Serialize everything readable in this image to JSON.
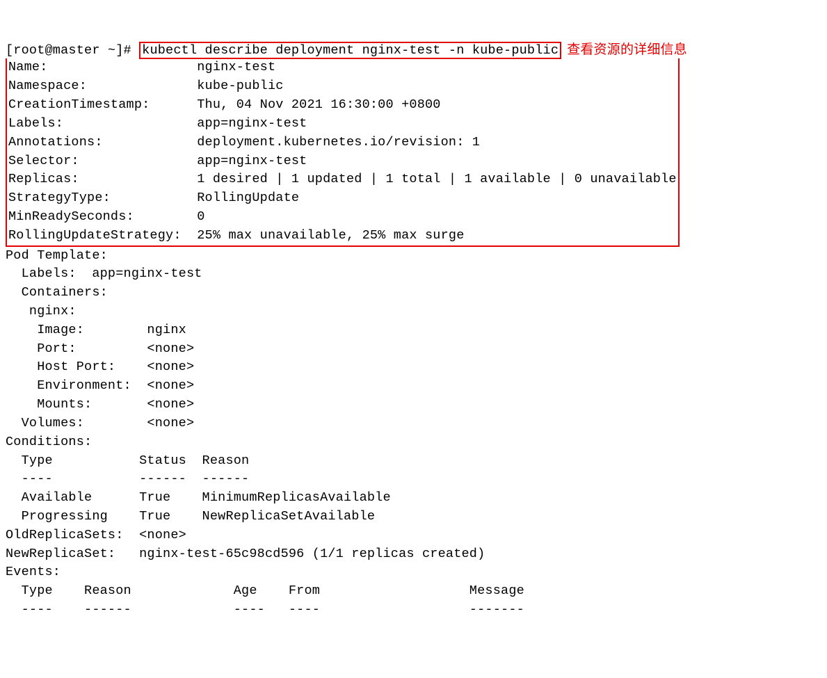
{
  "prompt": "[root@master ~]# ",
  "command": "kubectl describe deployment nginx-test -n kube-public",
  "annotation": "查看资源的详细信息",
  "fields": {
    "Name": "Name:                   nginx-test",
    "Namespace": "Namespace:              kube-public",
    "CreationTimestamp": "CreationTimestamp:      Thu, 04 Nov 2021 16:30:00 +0800",
    "Labels": "Labels:                 app=nginx-test",
    "Annotations": "Annotations:            deployment.kubernetes.io/revision: 1",
    "Selector": "Selector:               app=nginx-test",
    "Replicas": "Replicas:               1 desired | 1 updated | 1 total | 1 available | 0 unavailable",
    "StrategyType": "StrategyType:           RollingUpdate",
    "MinReadySeconds": "MinReadySeconds:        0",
    "RollingUpdateStrategy": "RollingUpdateStrategy:  25% max unavailable, 25% max surge"
  },
  "unboxed": [
    "Pod Template:",
    "  Labels:  app=nginx-test",
    "  Containers:",
    "   nginx:",
    "    Image:        nginx",
    "    Port:         <none>",
    "    Host Port:    <none>",
    "    Environment:  <none>",
    "    Mounts:       <none>",
    "  Volumes:        <none>",
    "Conditions:",
    "  Type           Status  Reason",
    "  ----           ------  ------",
    "  Available      True    MinimumReplicasAvailable",
    "  Progressing    True    NewReplicaSetAvailable",
    "OldReplicaSets:  <none>",
    "NewReplicaSet:   nginx-test-65c98cd596 (1/1 replicas created)",
    "Events:",
    "  Type    Reason             Age    From                   Message",
    "  ----    ------             ----   ----                   -------"
  ]
}
